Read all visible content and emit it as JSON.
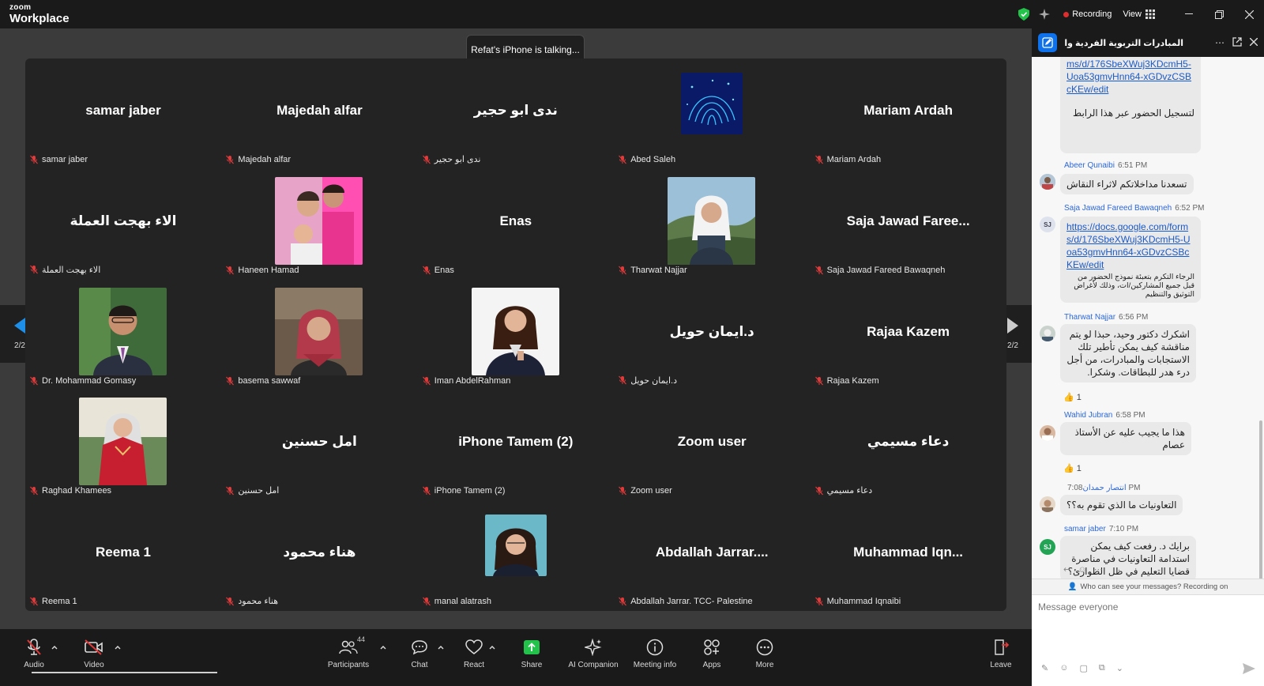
{
  "app": {
    "brand_top": "zoom",
    "brand_bottom": "Workplace"
  },
  "titlebar": {
    "recording_label": "Recording",
    "view_label": "View"
  },
  "speaking_banner": "Refat's iPhone is talking...",
  "pagination": {
    "left_page": "2/2",
    "right_page": "2/2"
  },
  "tiles": [
    {
      "big": "samar jaber",
      "label": "samar jaber"
    },
    {
      "big": "Majedah alfar",
      "label": "Majedah alfar"
    },
    {
      "big": "ندى ابو حجير",
      "label": "ندى ابو حجير"
    },
    {
      "big": "",
      "label": "Abed Saleh",
      "photo": "abstract-fingerprint"
    },
    {
      "big": "Mariam Ardah",
      "label": "Mariam Ardah"
    },
    {
      "big": "الاء بهجت العملة",
      "label": "الاء بهجت العملة"
    },
    {
      "big": "",
      "label": "Haneen Hamad",
      "photo": "family-photo"
    },
    {
      "big": "Enas",
      "label": "Enas"
    },
    {
      "big": "",
      "label": "Tharwat Najjar",
      "photo": "woman-outdoor"
    },
    {
      "big": "Saja Jawad Faree...",
      "label": "Saja Jawad Fareed Bawaqneh"
    },
    {
      "big": "",
      "label": "Dr. Mohammad Gomasy",
      "photo": "man-suit"
    },
    {
      "big": "",
      "label": "basema sawwaf",
      "photo": "woman-red-scarf"
    },
    {
      "big": "",
      "label": "Iman AbdelRahman",
      "photo": "woman-dark-suit"
    },
    {
      "big": "د.ايمان حويل",
      "label": "د.ايمان حويل"
    },
    {
      "big": "Rajaa Kazem",
      "label": "Rajaa Kazem"
    },
    {
      "big": "",
      "label": "Raghad Khamees",
      "photo": "woman-red-dress"
    },
    {
      "big": "امل حسنين",
      "label": "امل حسنين"
    },
    {
      "big": "iPhone Tamem (2)",
      "label": "iPhone Tamem (2)"
    },
    {
      "big": "Zoom user",
      "label": "Zoom user"
    },
    {
      "big": "دعاء مسيمي",
      "label": "دعاء مسيمي"
    },
    {
      "big": "Reema 1",
      "label": "Reema 1"
    },
    {
      "big": "هناء محمود",
      "label": "هناء محمود"
    },
    {
      "big": "",
      "label": "manal alatrash",
      "photo": "woman-portrait"
    },
    {
      "big": "Abdallah Jarrar....",
      "label": "Abdallah Jarrar. TCC- Palestine"
    },
    {
      "big": "Muhammad Iqn...",
      "label": "Muhammad Iqnaibi"
    }
  ],
  "toolbar": {
    "audio": "Audio",
    "video": "Video",
    "participants": "Participants",
    "participants_count": "44",
    "chat": "Chat",
    "react": "React",
    "share": "Share",
    "ai": "AI Companion",
    "meeting_info": "Meeting info",
    "apps": "Apps",
    "more": "More",
    "leave": "Leave"
  },
  "chat": {
    "title": "المبادرات التربوية الفردية والمج...",
    "messages": [
      {
        "link": "ms/d/176SbeXWuj3KDcmH5-Uoa53gmvHnn64-xGDvzCSBcKEw/edit",
        "text": "لتسجيل الحضور عبر هذا الرابط"
      },
      {
        "sender": "Abeer Qunaibi",
        "time": "6:51 PM",
        "text": "تسعدنا مداخلاتكم لاثراء النقاش"
      },
      {
        "sender": "Saja Jawad Fareed Bawaqneh",
        "time": "6:52 PM",
        "avatar": "SJ",
        "link": "https://docs.google.com/forms/d/176SbeXWuj3KDcmH5-Uoa53gmvHnn64-xGDvzCSBcKEw/edit",
        "text": "الرجاء التكرم بتعبئة نموذج الحضور من قبل جميع المشاركين/ات، وذلك لأغراض التوثيق والتنظيم"
      },
      {
        "sender": "Tharwat Najjar",
        "time": "6:56 PM",
        "text": "اشكرك دكتور وحيد، حبذا لو يتم مناقشة كيف يمكن تأطير تلك الاستجابات والمبادرات، من أجل درء هدر للبطاقات. وشكرا.",
        "reaction": "👍 1"
      },
      {
        "sender": "Wahid Jubran",
        "time": "6:58 PM",
        "text": "هذا ما يجيب عليه عن الأستاذ عصام",
        "reaction": "👍 1"
      },
      {
        "sender": "انتصار حمدان",
        "time": "7:08 PM",
        "text": "التعاونيات ما الذي تقوم به؟؟"
      },
      {
        "sender": "samar jaber",
        "time": "7:10 PM",
        "avatar": "SJ",
        "text": "برايك د. رفعت كيف يمكن استدامة التعاونيات في مناصرة قضايا التعليم في ظل الطوارئ؟"
      }
    ],
    "who_can_see": "Who can see your messages? Recording on",
    "input_placeholder": "Message everyone"
  },
  "colors": {
    "accent": "#0e72ed",
    "recording": "#e02e2e",
    "mute": "#e03a3a",
    "share": "#23c24a",
    "link": "#1a5ac9",
    "sender": "#2d68d8"
  }
}
